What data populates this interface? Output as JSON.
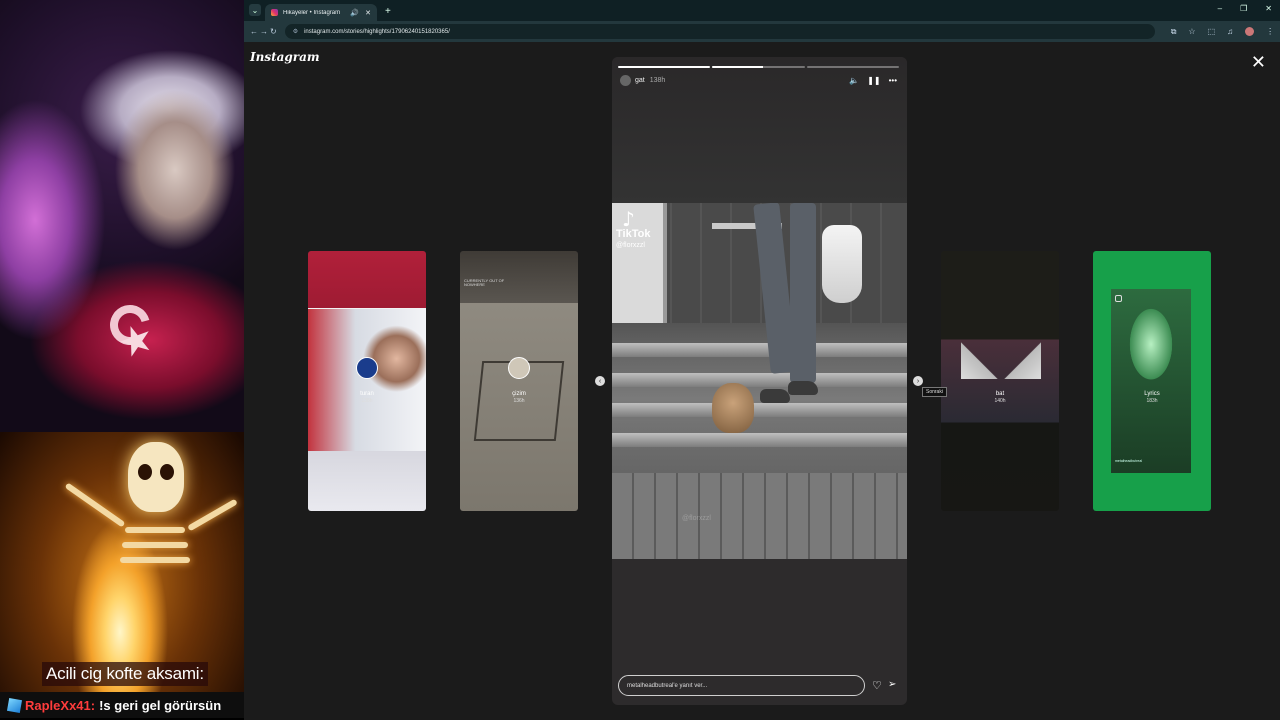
{
  "stream": {
    "caption": "Acili cig kofte aksami:",
    "chat": {
      "user": "RapleXx41:",
      "message": "!s geri gel görürsün"
    }
  },
  "browser": {
    "tab": {
      "title": "Hikayeler • Instagram"
    },
    "url": "instagram.com/stories/highlights/17906240151820365/"
  },
  "instagram": {
    "logo": "Instagram",
    "story": {
      "username": "gat",
      "time": "138h",
      "progress": [
        1.0,
        0.55,
        0.0
      ],
      "tiktok_brand": "TikTok",
      "tiktok_handle": "@florxzzl",
      "watermark": "@florxzzl",
      "reply_placeholder": "metalheadbutreal'e yanıt ver..."
    },
    "next_tooltip": "Sonraki",
    "previews": [
      {
        "name": "turan",
        "time": "138h"
      },
      {
        "name": "çizim",
        "time": "136h"
      },
      {
        "name": "bat",
        "time": "140h"
      },
      {
        "name": "Lyrics",
        "time": "183h"
      }
    ],
    "preview_texts": {
      "sketch_header": "CURRENTLY OUT OF\nNOWHERE",
      "lyrics_footer": "metalheadbutreal"
    }
  }
}
